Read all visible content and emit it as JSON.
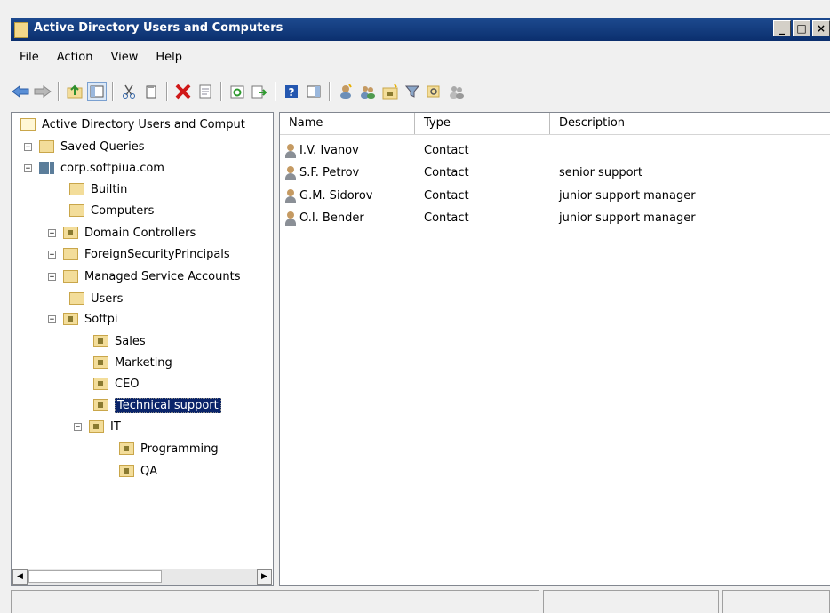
{
  "window": {
    "title": "Active Directory Users and Computers",
    "buttons": [
      "_",
      "□",
      "×"
    ]
  },
  "menu": [
    "File",
    "Action",
    "View",
    "Help"
  ],
  "toolbar": {
    "icons": [
      "back-icon",
      "forward-icon",
      "up-folder-icon",
      "show-console-tree-icon",
      "cut-icon",
      "copy-icon",
      "delete-icon",
      "properties-icon",
      "refresh-icon",
      "export-list-icon",
      "help-icon",
      "show-action-pane-icon",
      "new-user-icon",
      "new-group-icon",
      "new-ou-icon",
      "filter-icon",
      "find-icon",
      "add-to-group-icon"
    ]
  },
  "tree": {
    "root": "Active Directory Users and Comput",
    "saved_queries": "Saved Queries",
    "domain": "corp.softpiua.com",
    "builtin": "Builtin",
    "computers": "Computers",
    "domain_controllers": "Domain Controllers",
    "foreign": "ForeignSecurityPrincipals",
    "managed": "Managed Service Accounts",
    "users": "Users",
    "softpi": "Softpi",
    "sales": "Sales",
    "marketing": "Marketing",
    "ceo": "CEO",
    "tech_support": "Technical support",
    "it": "IT",
    "programming": "Programming",
    "qa": "QA",
    "expand_plus": "+",
    "expand_minus": "−"
  },
  "list": {
    "columns": [
      "Name",
      "Type",
      "Description"
    ],
    "rows": [
      {
        "name": "I.V. Ivanov",
        "type": "Contact",
        "description": ""
      },
      {
        "name": "S.F. Petrov",
        "type": "Contact",
        "description": "senior support"
      },
      {
        "name": "G.M. Sidorov",
        "type": "Contact",
        "description": "junior support manager"
      },
      {
        "name": "O.I. Bender",
        "type": "Contact",
        "description": "junior support manager"
      }
    ]
  },
  "colors": {
    "title_bar": "#0b2f6e",
    "selection": "#0a246a",
    "folder": "#f3dd9a"
  }
}
